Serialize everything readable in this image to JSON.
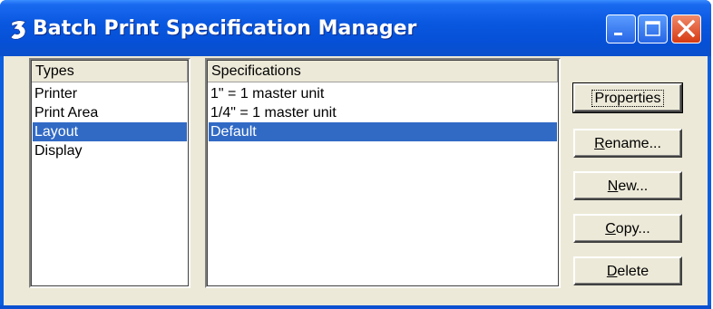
{
  "window": {
    "title": "Batch Print Specification Manager",
    "icon": "batch-print-app-icon",
    "controls": {
      "minimize": "minimize-icon",
      "maximize": "maximize-icon",
      "close": "close-icon"
    },
    "colors": {
      "titlebar": "#0a58e0",
      "client": "#ece9d8",
      "selection": "#316ac5"
    }
  },
  "types": {
    "header": "Types",
    "items": [
      "Printer",
      "Print Area",
      "Layout",
      "Display"
    ],
    "selected": "Layout"
  },
  "specifications": {
    "header": "Specifications",
    "items": [
      "1\" = 1 master unit",
      "1/4\" = 1 master unit",
      "Default"
    ],
    "selected": "Default"
  },
  "buttons": {
    "properties": "Properties",
    "rename_pre": "",
    "rename_ul": "R",
    "rename_post": "ename...",
    "new_pre": "",
    "new_ul": "N",
    "new_post": "ew...",
    "copy_pre": "",
    "copy_ul": "C",
    "copy_post": "opy...",
    "delete_pre": "",
    "delete_ul": "D",
    "delete_post": "elete"
  }
}
